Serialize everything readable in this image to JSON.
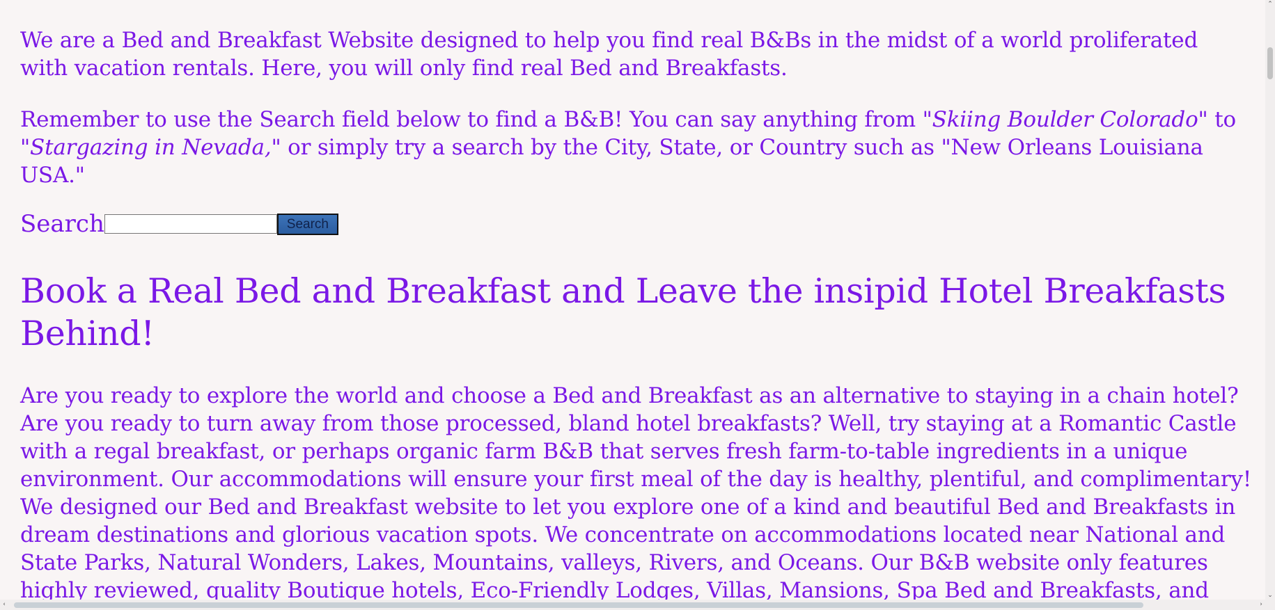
{
  "intro": {
    "paragraph1": "We are a Bed and Breakfast Website designed to help you find real B&Bs in the midst of a world proliferated with vacation rentals. Here, you will only find real Bed and Breakfasts.",
    "paragraph2_before": "Remember to use the Search field below to find a B&B! You can say anything from ",
    "paragraph2_example1": "\"Skiing Boulder Colorado\"",
    "paragraph2_middle": " to ",
    "paragraph2_example2": "\"Stargazing in Nevada,\"",
    "paragraph2_after": " or simply try a search by the City, State, or Country such as \"New Orleans Louisiana USA.\""
  },
  "search": {
    "label": "Search",
    "value": "",
    "placeholder": "",
    "button_label": "Search"
  },
  "main": {
    "heading": "Book a Real Bed and Breakfast and Leave the insipid Hotel Breakfasts Behind!",
    "body": "Are you ready to explore the world and choose a Bed and Breakfast as an alternative to staying in a chain hotel? Are you ready to turn away from those processed, bland hotel breakfasts? Well, try staying at a Romantic Castle with a regal breakfast, or perhaps organic farm B&B that serves fresh farm-to-table ingredients in a unique environment. Our accommodations will ensure your first meal of the day is healthy, plentiful, and complimentary! We designed our Bed and Breakfast website to let you explore one of a kind and beautiful Bed and Breakfasts in dream destinations and glorious vacation spots. We concentrate on accommodations located near National and State Parks, Natural Wonders, Lakes, Mountains, valleys, Rivers, and Oceans. Our B&B website only features highly reviewed, quality Boutique hotels, Eco-Friendly Lodges, Villas, Mansions, Spa Bed and Breakfasts, and"
  },
  "scrollbars": {
    "up_arrow": "⌃",
    "down_arrow": "⌄",
    "left_arrow": "‹",
    "right_arrow": "›"
  },
  "colors": {
    "text": "#7a18e6",
    "background": "#f9f5f5",
    "button": "#3d73b8"
  }
}
